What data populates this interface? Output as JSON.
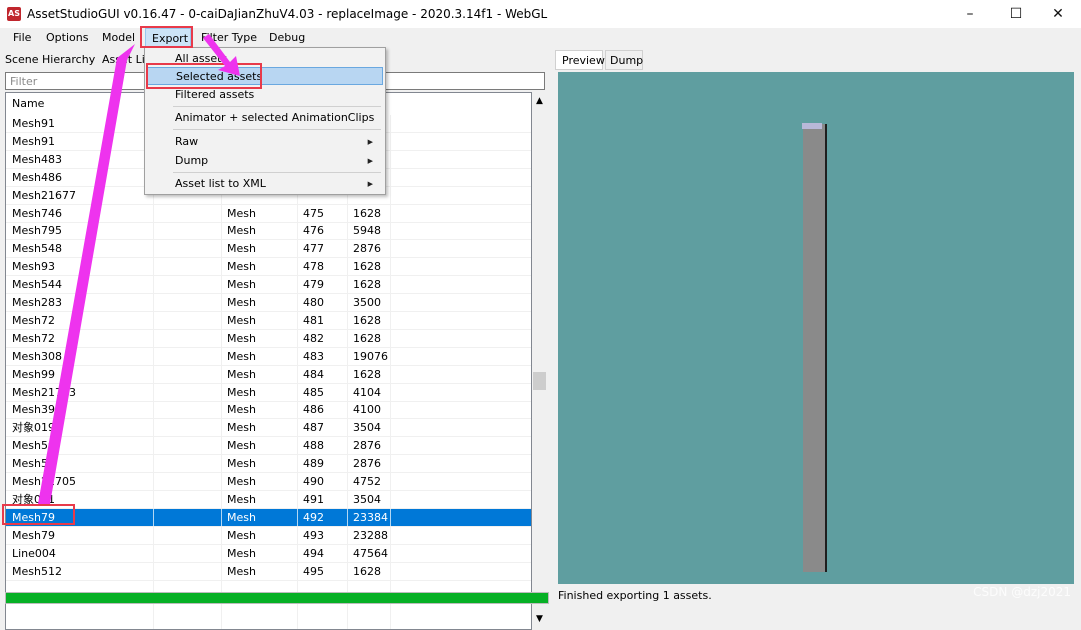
{
  "window": {
    "title": "AssetStudioGUI v0.16.47 - 0-caiDaJianZhuV4.03 - replaceImage - 2020.3.14f1 - WebGL",
    "icon_text": "AS",
    "minimize": "–",
    "maximize": "☐",
    "close": "✕"
  },
  "menu": {
    "file": "File",
    "options": "Options",
    "model": "Model",
    "export": "Export",
    "filter_type": "Filter Type",
    "debug": "Debug"
  },
  "left_tabs": {
    "scene_hierarchy": "Scene Hierarchy",
    "asset_list": "Asset List"
  },
  "filter": {
    "placeholder": "Filter"
  },
  "table": {
    "headers": {
      "name": "Name"
    },
    "rows": [
      {
        "name": "Mesh91",
        "type": "",
        "id": "",
        "size": ""
      },
      {
        "name": "Mesh91",
        "type": "",
        "id": "",
        "size": ""
      },
      {
        "name": "Mesh483",
        "type": "",
        "id": "",
        "size": ""
      },
      {
        "name": "Mesh486",
        "type": "",
        "id": "",
        "size": ""
      },
      {
        "name": "Mesh21677",
        "type": "",
        "id": "",
        "size": ""
      },
      {
        "name": "Mesh746",
        "type": "Mesh",
        "id": "475",
        "size": "1628"
      },
      {
        "name": "Mesh795",
        "type": "Mesh",
        "id": "476",
        "size": "5948"
      },
      {
        "name": "Mesh548",
        "type": "Mesh",
        "id": "477",
        "size": "2876"
      },
      {
        "name": "Mesh93",
        "type": "Mesh",
        "id": "478",
        "size": "1628"
      },
      {
        "name": "Mesh544",
        "type": "Mesh",
        "id": "479",
        "size": "1628"
      },
      {
        "name": "Mesh283",
        "type": "Mesh",
        "id": "480",
        "size": "3500"
      },
      {
        "name": "Mesh72",
        "type": "Mesh",
        "id": "481",
        "size": "1628"
      },
      {
        "name": "Mesh72",
        "type": "Mesh",
        "id": "482",
        "size": "1628"
      },
      {
        "name": "Mesh308",
        "type": "Mesh",
        "id": "483",
        "size": "19076"
      },
      {
        "name": "Mesh99",
        "type": "Mesh",
        "id": "484",
        "size": "1628"
      },
      {
        "name": "Mesh21723",
        "type": "Mesh",
        "id": "485",
        "size": "4104"
      },
      {
        "name": "Mesh397",
        "type": "Mesh",
        "id": "486",
        "size": "4100"
      },
      {
        "name": "对象019",
        "type": "Mesh",
        "id": "487",
        "size": "3504"
      },
      {
        "name": "Mesh50",
        "type": "Mesh",
        "id": "488",
        "size": "2876"
      },
      {
        "name": "Mesh50",
        "type": "Mesh",
        "id": "489",
        "size": "2876"
      },
      {
        "name": "Mesh21705",
        "type": "Mesh",
        "id": "490",
        "size": "4752"
      },
      {
        "name": "对象021",
        "type": "Mesh",
        "id": "491",
        "size": "3504"
      },
      {
        "name": "Mesh79",
        "type": "Mesh",
        "id": "492",
        "size": "23384"
      },
      {
        "name": "Mesh79",
        "type": "Mesh",
        "id": "493",
        "size": "23288"
      },
      {
        "name": "Line004",
        "type": "Mesh",
        "id": "494",
        "size": "47564"
      },
      {
        "name": "Mesh512",
        "type": "Mesh",
        "id": "495",
        "size": "1628"
      }
    ]
  },
  "export_menu": {
    "all_assets": "All assets",
    "selected_assets": "Selected assets",
    "filtered_assets": "Filtered assets",
    "animator": "Animator + selected AnimationClips",
    "raw": "Raw",
    "dump": "Dump",
    "asset_list_xml": "Asset list to XML",
    "submenu_arrow": "▶"
  },
  "right_tabs": {
    "preview": "Preview",
    "dump": "Dump"
  },
  "status": {
    "text": "Finished exporting 1 assets."
  },
  "watermark": "CSDN @dzj2021",
  "colors": {
    "selection": "#0078d7",
    "preview_bg": "#5f9ea0",
    "progress": "#06b025",
    "annotation": "#e83a4a",
    "arrow": "#ee33ee"
  }
}
